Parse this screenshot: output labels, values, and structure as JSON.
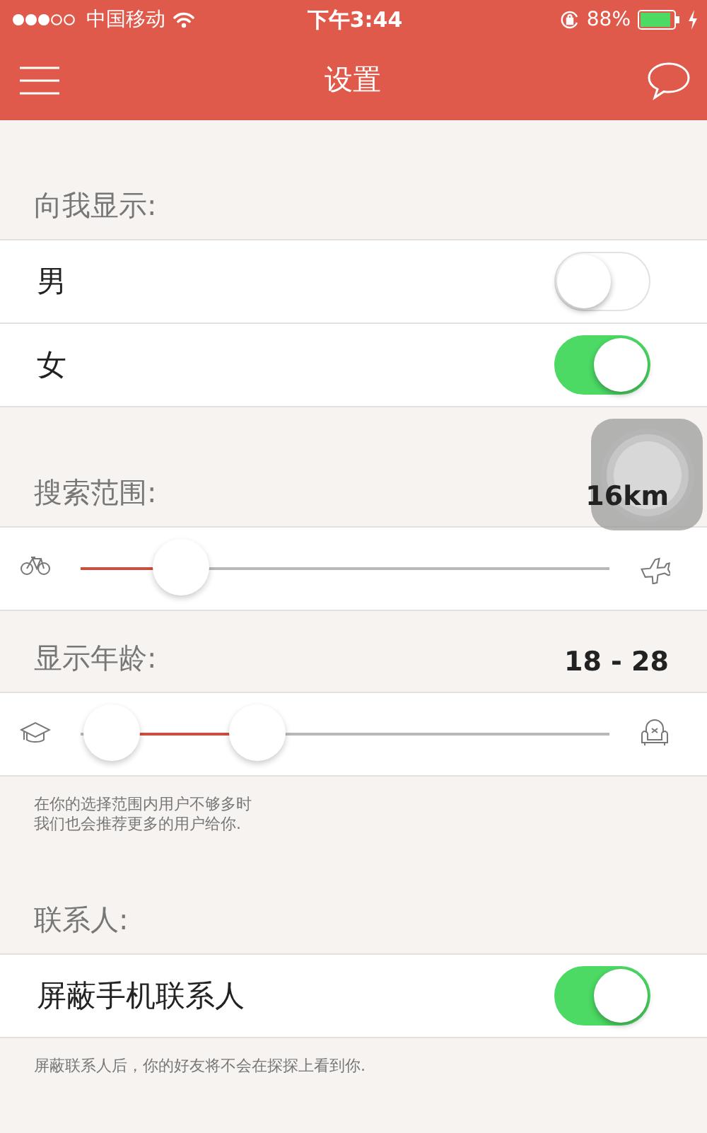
{
  "status_bar": {
    "carrier": "中国移动",
    "time": "下午3:44",
    "battery": "88%"
  },
  "nav": {
    "title": "设置"
  },
  "sections": [
    {
      "kind": "toggles",
      "title": "向我显示:",
      "rows": [
        {
          "label": "男",
          "on": false
        },
        {
          "label": "女",
          "on": true
        }
      ]
    },
    {
      "kind": "slider",
      "title": "搜索范围:",
      "value": "16km",
      "thumbs": [
        {
          "level": 0.19
        }
      ]
    },
    {
      "kind": "slider",
      "title": "显示年龄:",
      "value": "18 - 28",
      "thumbs": [
        {
          "level": 0.06
        },
        {
          "level": 0.335
        }
      ],
      "note": [
        "在你的选择范围内用户不够多时",
        "我们也会推荐更多的用户给你."
      ]
    },
    {
      "kind": "toggles",
      "title": "联系人:",
      "rows": [
        {
          "label": "屏蔽手机联系人",
          "on": true
        }
      ],
      "note": [
        "屏蔽联系人后，你的好友将不会在探探上看到你."
      ]
    }
  ]
}
